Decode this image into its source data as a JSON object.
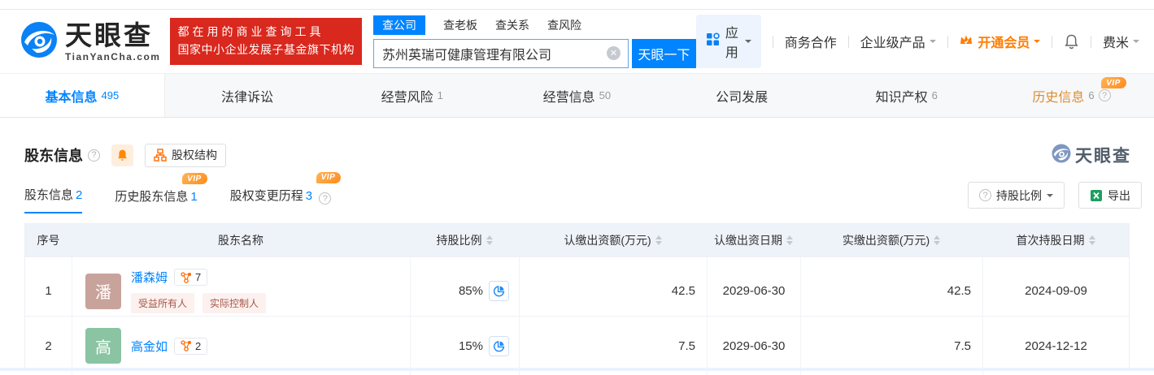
{
  "brand": {
    "name": "天眼查",
    "domain": "TianYanCha.com",
    "slogan_line1": "都在用的商业查询工具",
    "slogan_line2": "国家中小企业发展子基金旗下机构"
  },
  "search": {
    "tabs": [
      {
        "label": "查公司"
      },
      {
        "label": "查老板"
      },
      {
        "label": "查关系"
      },
      {
        "label": "查风险"
      }
    ],
    "value": "苏州英瑞可健康管理有限公司",
    "button": "天眼一下"
  },
  "topmenu": {
    "apps": "应用",
    "business": "商务合作",
    "enterprise": "企业级产品",
    "vip": "开通会员",
    "user": "费米"
  },
  "nav": {
    "tabs": [
      {
        "label": "基本信息",
        "count": "495"
      },
      {
        "label": "法律诉讼",
        "count": ""
      },
      {
        "label": "经营风险",
        "count": "1"
      },
      {
        "label": "经营信息",
        "count": "50"
      },
      {
        "label": "公司发展",
        "count": ""
      },
      {
        "label": "知识产权",
        "count": "6"
      },
      {
        "label": "历史信息",
        "count": "6"
      }
    ]
  },
  "section": {
    "title": "股东信息",
    "equity_structure": "股权结构",
    "watermark": "天眼查",
    "vip": "VIP",
    "subtabs": [
      {
        "label": "股东信息",
        "count": "2"
      },
      {
        "label": "历史股东信息",
        "count": "1"
      },
      {
        "label": "股权变更历程",
        "count": "3"
      }
    ],
    "actions": {
      "ratio": "持股比例",
      "export": "导出"
    }
  },
  "table": {
    "headers": [
      "序号",
      "股东名称",
      "持股比例",
      "认缴出资额(万元)",
      "认缴出资日期",
      "实缴出资额(万元)",
      "首次持股日期"
    ],
    "rows": [
      {
        "index": "1",
        "avatar": "潘",
        "name": "潘森姆",
        "relations": "7",
        "tags": {
          "0": "受益所有人",
          "1": "实际控制人"
        },
        "ratio": "85%",
        "subscribed": "42.5",
        "subscribed_date": "2029-06-30",
        "paid": "42.5",
        "first_date": "2024-09-09"
      },
      {
        "index": "2",
        "avatar": "高",
        "name": "高金如",
        "relations": "2",
        "ratio": "15%",
        "subscribed": "7.5",
        "subscribed_date": "2029-06-30",
        "paid": "7.5",
        "first_date": "2024-12-12"
      }
    ]
  }
}
